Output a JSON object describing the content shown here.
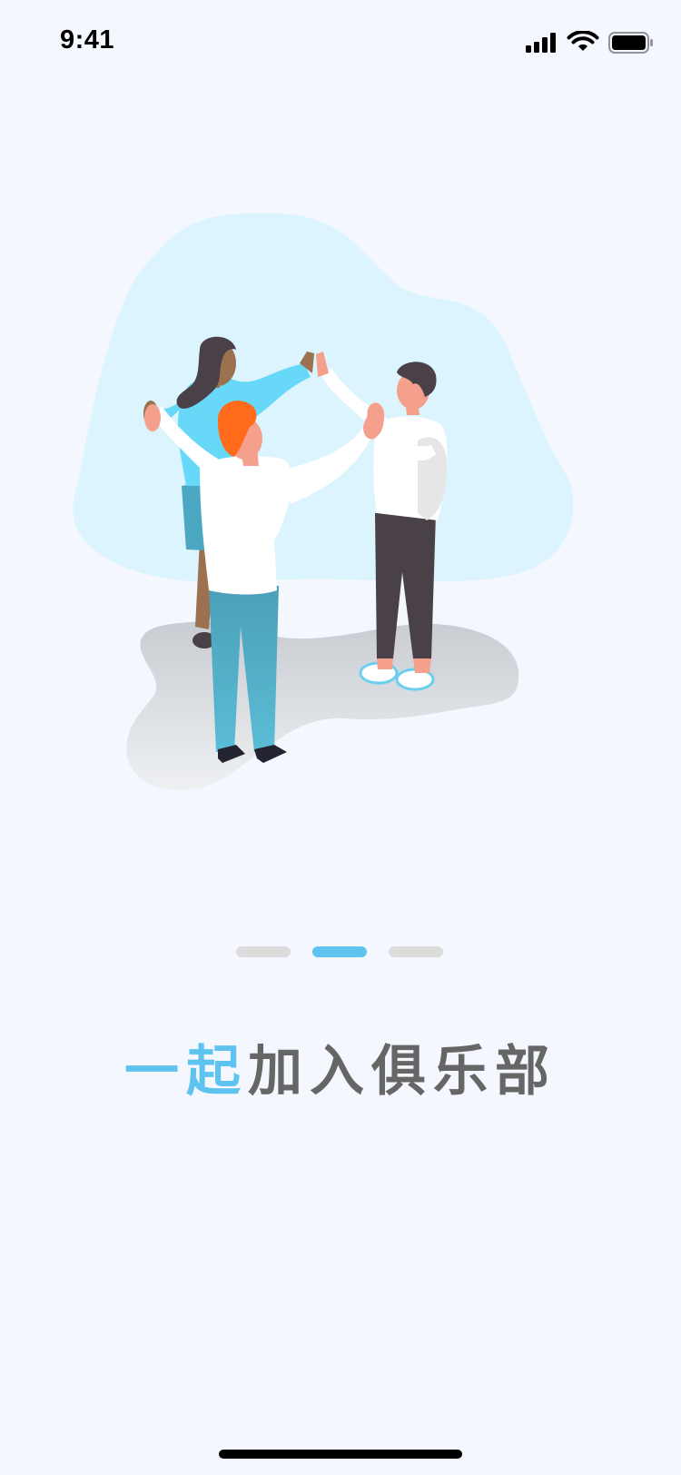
{
  "status_bar": {
    "time": "9:41",
    "icons": [
      "cellular-signal-icon",
      "wifi-icon",
      "battery-icon"
    ]
  },
  "illustration": {
    "subject": "people-high-five-illustration",
    "colors": {
      "blob": "#dcf4fd",
      "shadow": "#d8dade",
      "accent_hair": "#ff6b1a",
      "shirt_blue": "#67d8f7",
      "pants_teal": "#4ba7c2",
      "pants_dark": "#4a4048"
    }
  },
  "pager": {
    "count": 3,
    "active_index": 1
  },
  "title": {
    "highlight": "一起",
    "rest": "加入俱乐部"
  },
  "colors": {
    "background": "#f4f8fe",
    "accent": "#5ec3ef",
    "text": "#666666",
    "dot_inactive": "#dcdcdc"
  }
}
